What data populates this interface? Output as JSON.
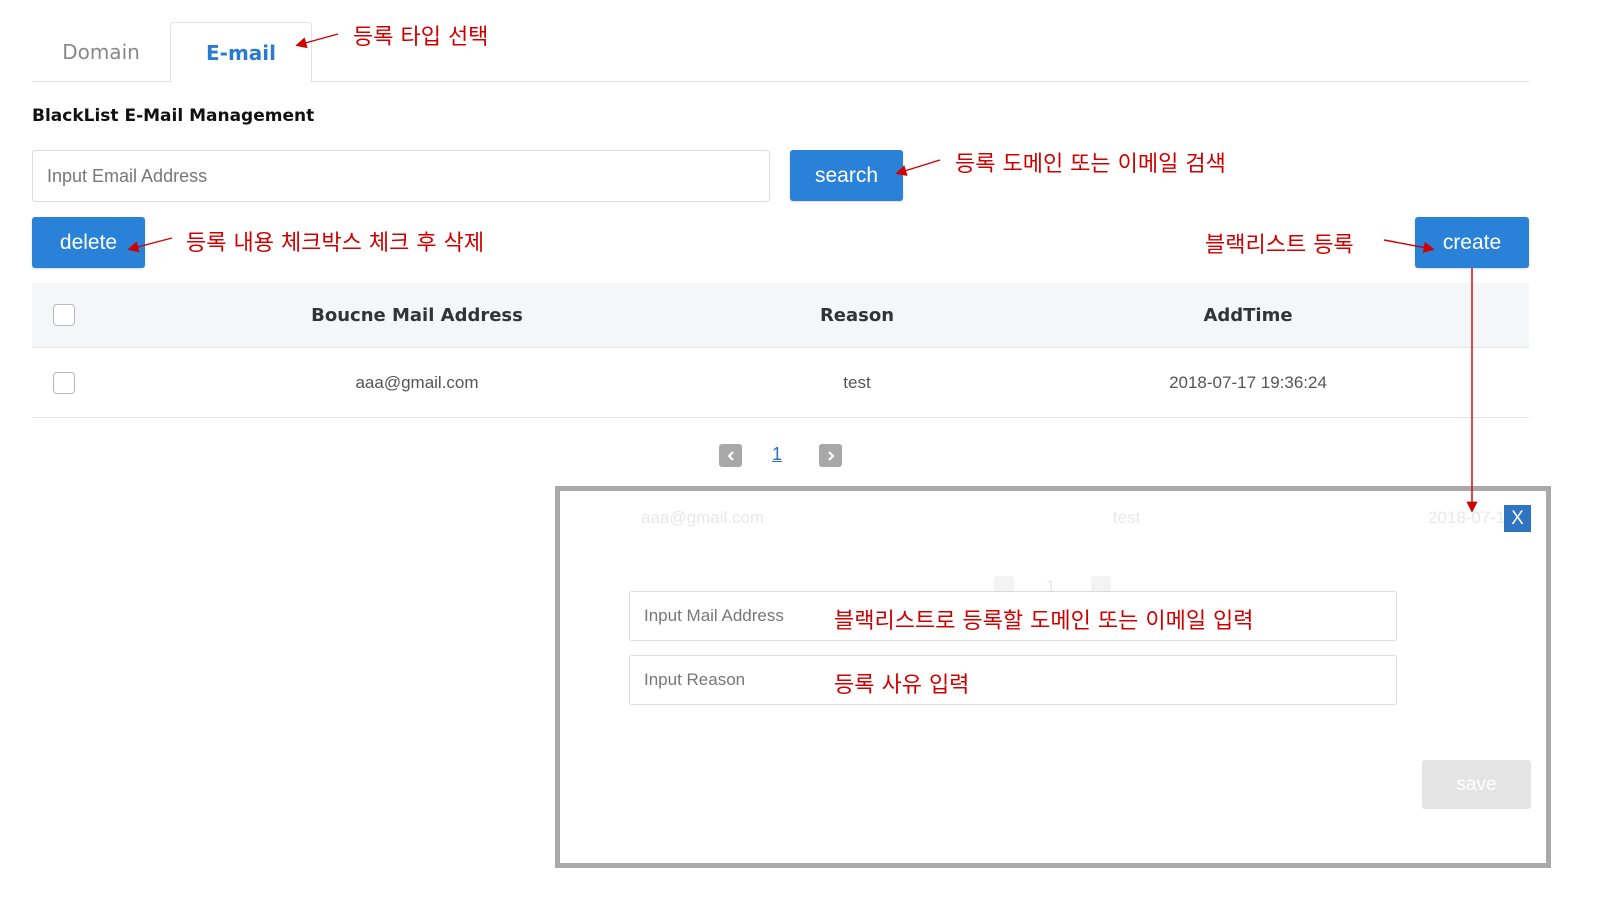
{
  "tabs": [
    {
      "label": "Domain",
      "active": false
    },
    {
      "label": "E-mail",
      "active": true
    }
  ],
  "section_title": "BlackList E-Mail Management",
  "search": {
    "placeholder": "Input Email Address",
    "button_label": "search"
  },
  "actions": {
    "delete_label": "delete",
    "create_label": "create"
  },
  "table": {
    "columns": [
      "Boucne Mail Address",
      "Reason",
      "AddTime"
    ],
    "rows": [
      {
        "address": "aaa@gmail.com",
        "reason": "test",
        "add_time": "2018-07-17 19:36:24"
      }
    ]
  },
  "pagination": {
    "current_page": "1"
  },
  "modal": {
    "close_label": "X",
    "mail_placeholder": "Input Mail Address",
    "reason_placeholder": "Input Reason",
    "save_label": "save",
    "background_row": {
      "address": "aaa@gmail.com",
      "reason": "test",
      "add_time": "2018-07-1"
    },
    "background_page": "1"
  },
  "annotations": {
    "tab_select": "등록 타입 선택",
    "search": "등록 도메인 또는 이메일 검색",
    "delete": "등록 내용 체크박스 체크 후 삭제",
    "create": "블랙리스트 등록",
    "mail_input": "블랙리스트로 등록할 도메인 또는 이메일 입력",
    "reason_input": "등록 사유 입력"
  },
  "colors": {
    "primary": "#2a82d8",
    "annotation": "#d00000",
    "close": "#2f74c0"
  }
}
